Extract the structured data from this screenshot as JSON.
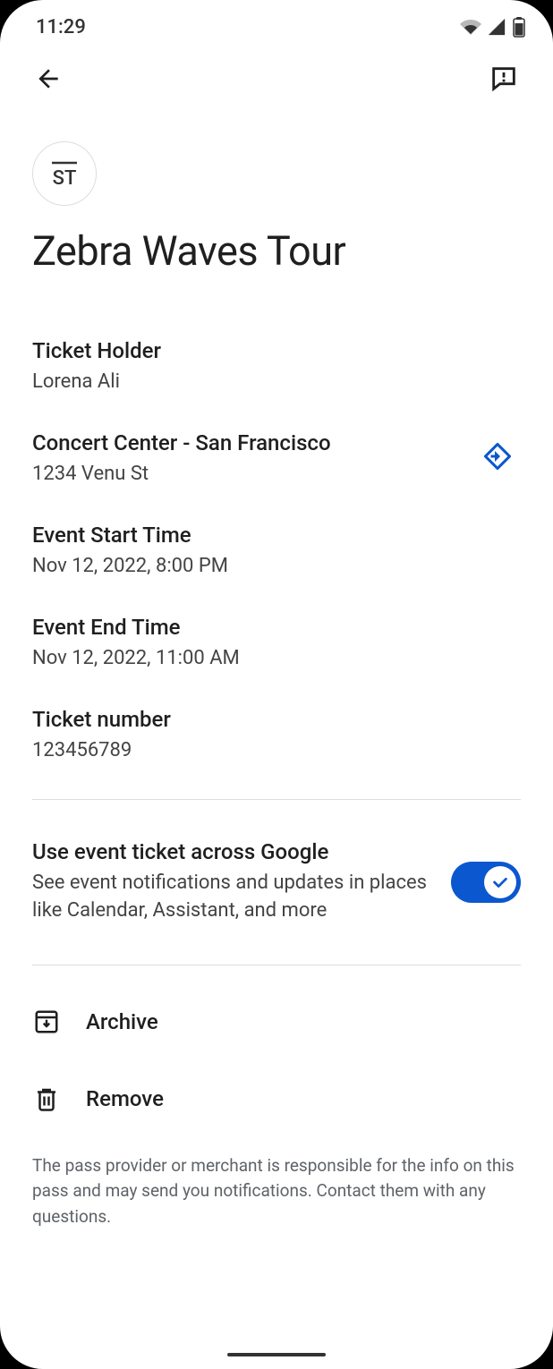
{
  "status": {
    "time": "11:29"
  },
  "event": {
    "source_logo": "ST",
    "title": "Zebra Waves Tour"
  },
  "fields": {
    "holder": {
      "label": "Ticket Holder",
      "value": "Lorena Ali"
    },
    "venue": {
      "label": "Concert Center - San Francisco",
      "value": "1234 Venu St"
    },
    "start": {
      "label": "Event Start Time",
      "value": "Nov 12, 2022, 8:00 PM"
    },
    "end": {
      "label": "Event End Time",
      "value": "Nov 12, 2022, 11:00 AM"
    },
    "ticket_number": {
      "label": "Ticket number",
      "value": "123456789"
    }
  },
  "toggle": {
    "title": "Use event ticket across Google",
    "description": "See event notifications and updates in places like Calendar, Assistant, and more"
  },
  "actions": {
    "archive": "Archive",
    "remove": "Remove"
  },
  "footer": "The pass provider or merchant is responsible for the info on this pass and may send you notifications. Contact them with any questions."
}
